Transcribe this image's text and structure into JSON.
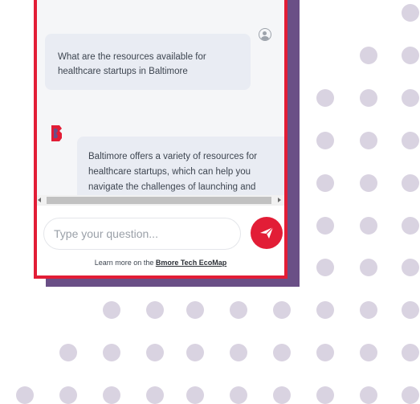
{
  "chat": {
    "messages": [
      {
        "role": "user",
        "text": "What are the resources available for healthcare startups in Baltimore"
      },
      {
        "role": "assistant",
        "text": "Baltimore offers a variety of resources for healthcare startups, which can help you navigate the challenges of launching and"
      }
    ],
    "input": {
      "placeholder": "Type your question...",
      "value": ""
    },
    "footer": {
      "prefix": "Learn more on the ",
      "link_text": "Bmore Tech EcoMap"
    }
  },
  "icons": {
    "user_avatar": "user-circle-icon",
    "bot_avatar": "bmore-logo-icon",
    "send": "paper-plane-icon",
    "scroll_left": "triangle-left-icon",
    "scroll_right": "triangle-right-icon"
  },
  "colors": {
    "accent": "#e21d36",
    "shadow_panel": "#6a4f86",
    "dots": "#d9d3e1",
    "bubble": "#e9ecf3",
    "chat_background": "#f5f6f8",
    "text": "#3d4550"
  }
}
